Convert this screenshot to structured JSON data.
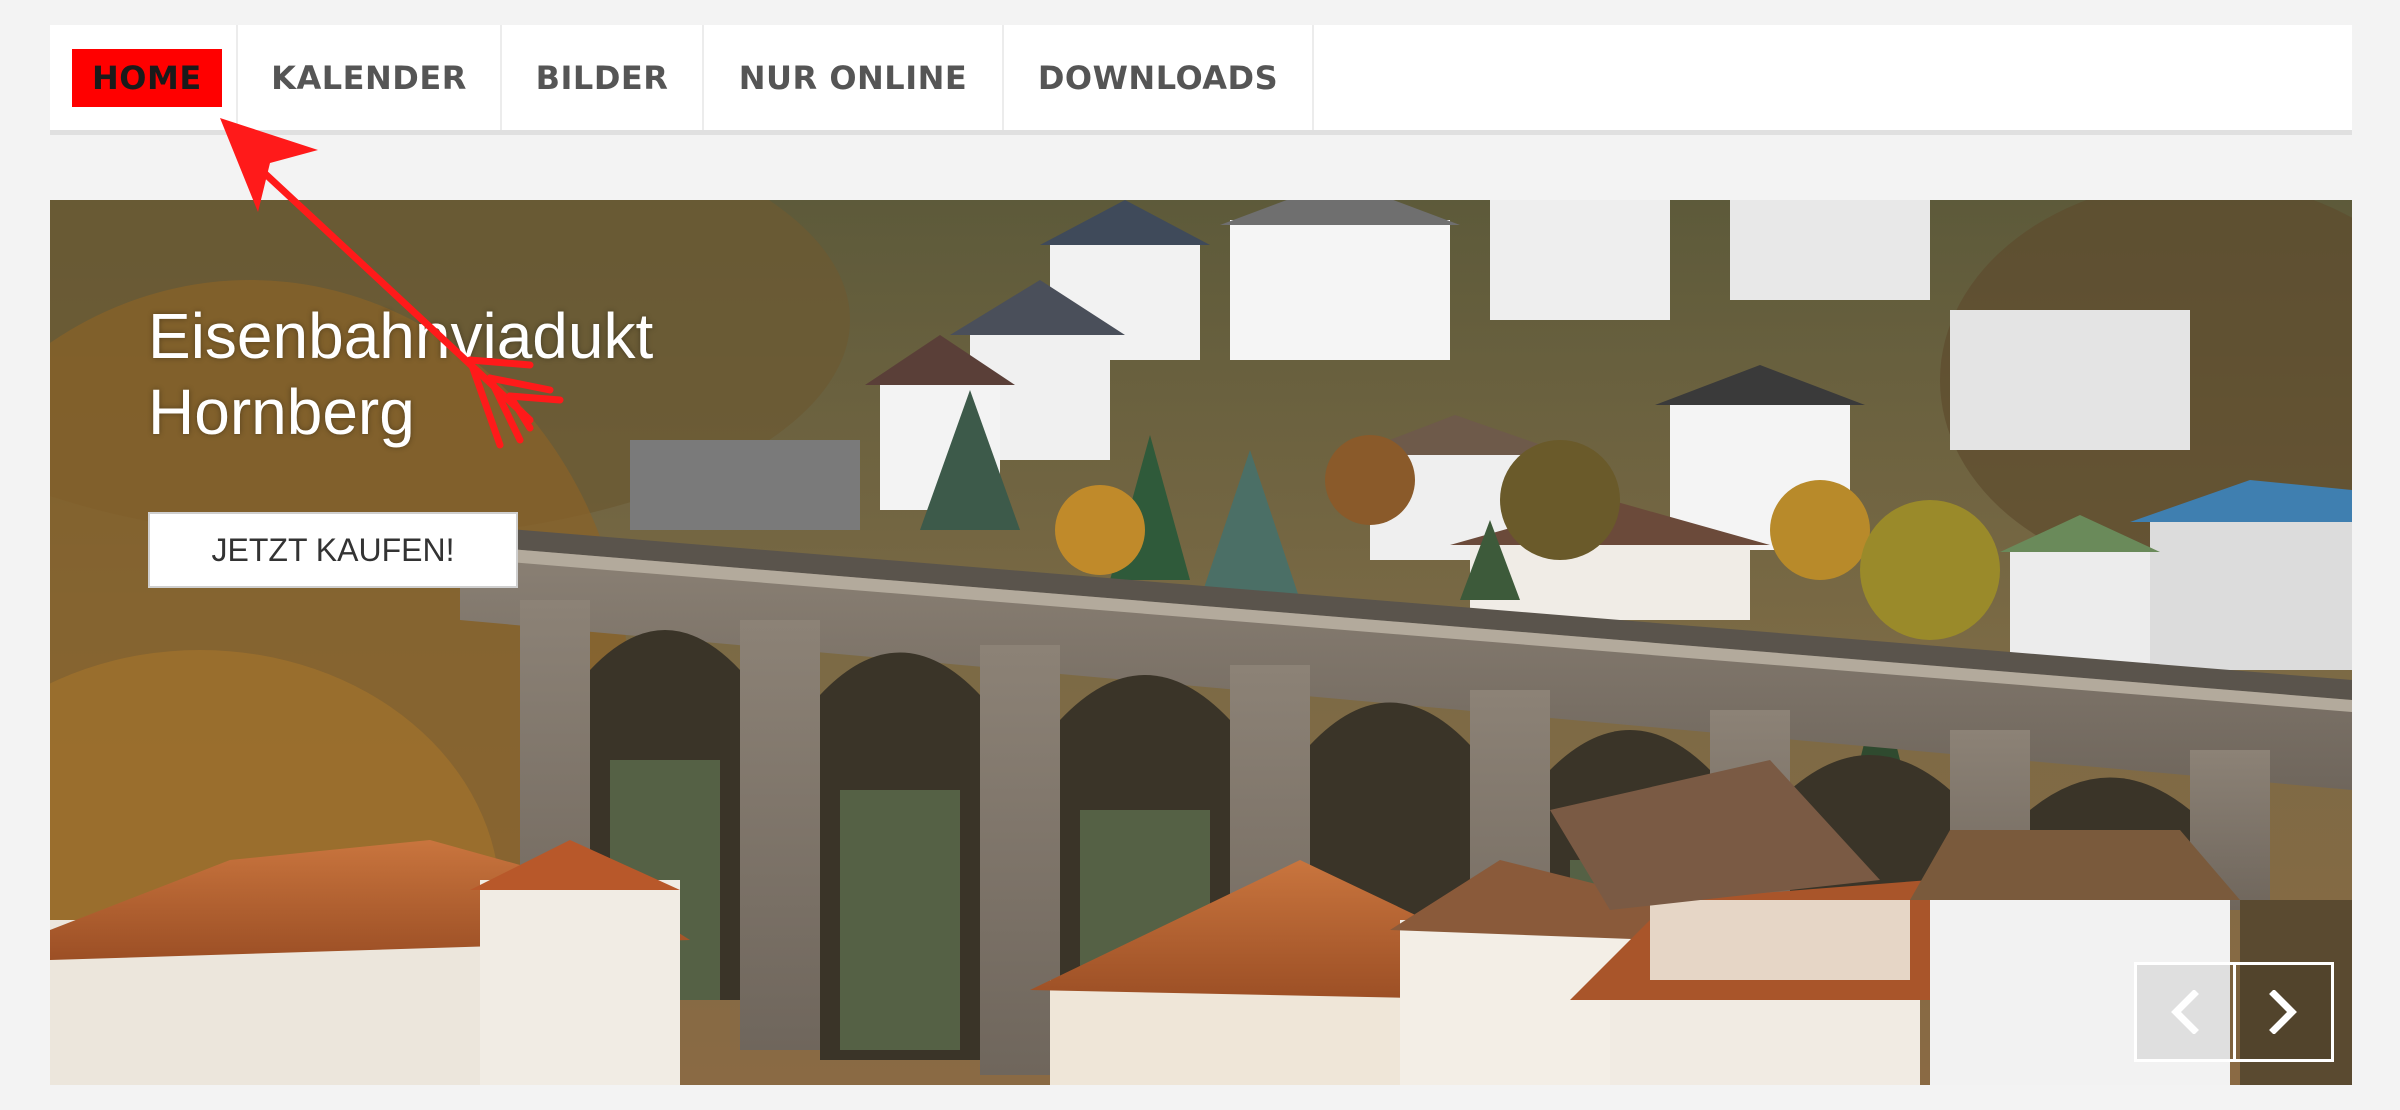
{
  "nav": {
    "items": [
      {
        "label": "HOME",
        "active": true
      },
      {
        "label": "KALENDER",
        "active": false
      },
      {
        "label": "BILDER",
        "active": false
      },
      {
        "label": "NUR ONLINE",
        "active": false
      },
      {
        "label": "DOWNLOADS",
        "active": false
      }
    ]
  },
  "hero": {
    "title_line1": "Eisenbahnviadukt",
    "title_line2": "Hornberg",
    "button_label": "JETZT KAUFEN!",
    "prev_icon": "chevron-left-icon",
    "next_icon": "chevron-right-icon"
  },
  "annotation": {
    "type": "arrow",
    "color": "#ff0000",
    "points_to": "HOME"
  },
  "colors": {
    "active_nav_bg": "#ff0000",
    "nav_text": "#555555",
    "page_bg": "#f3f3f3"
  }
}
